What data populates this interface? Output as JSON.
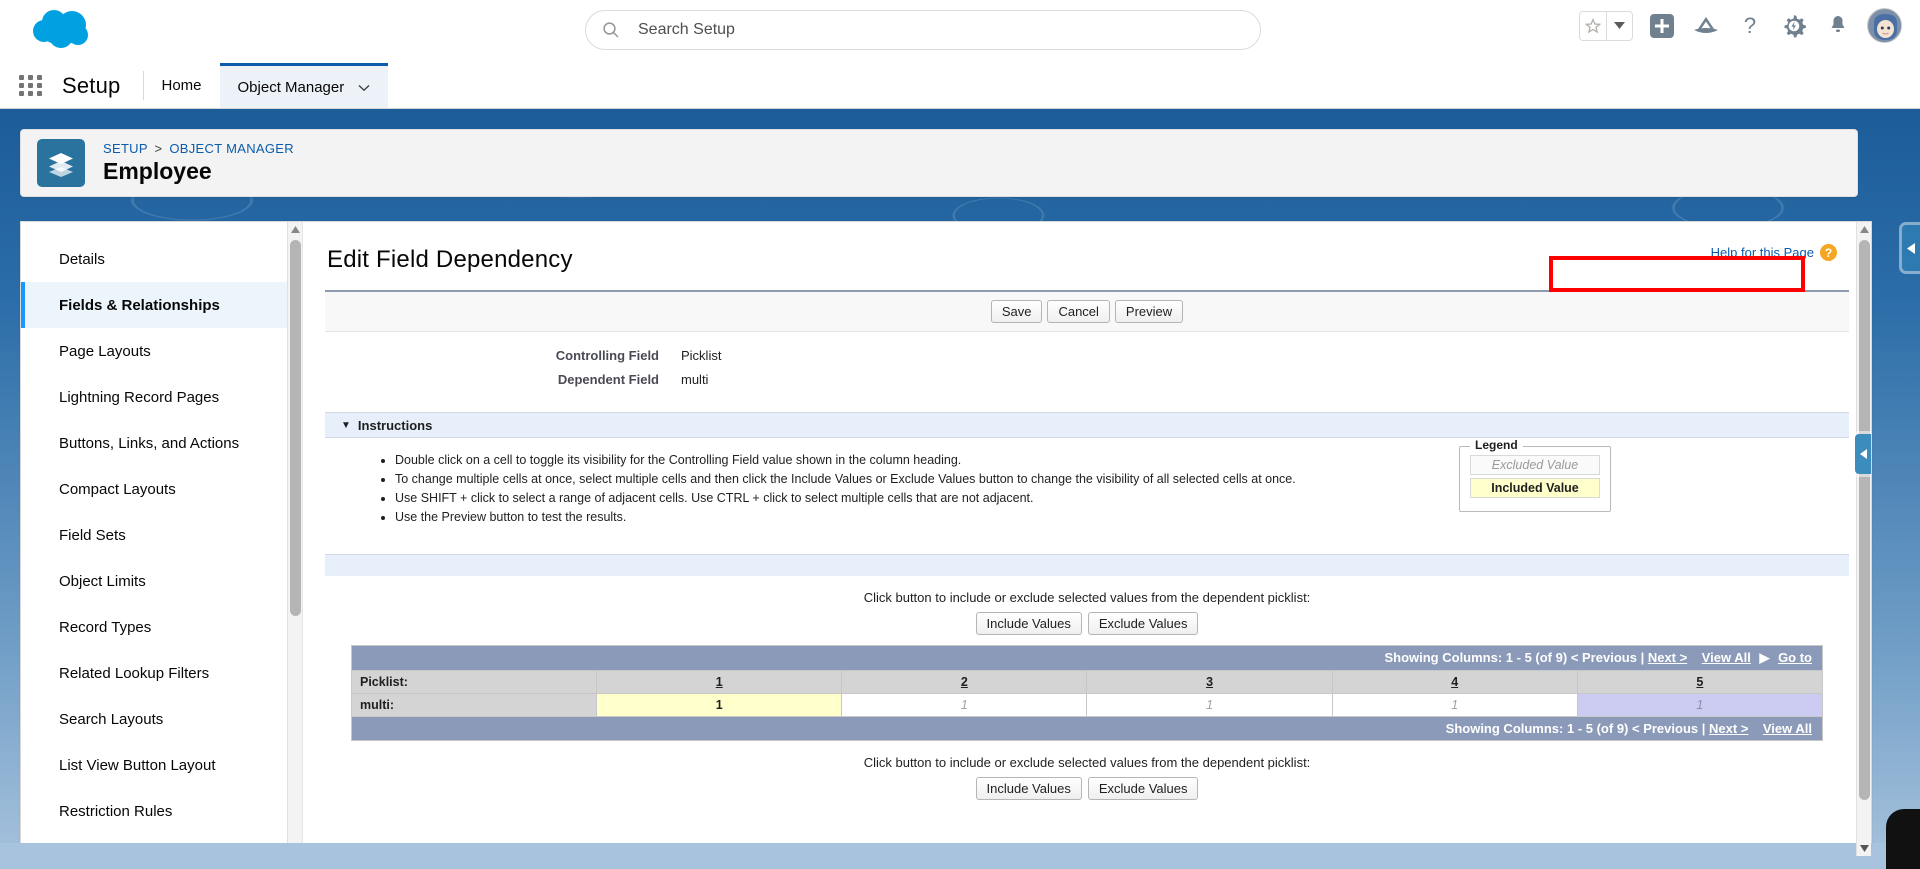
{
  "header": {
    "logo_name": "salesforce-cloud-logo",
    "search": {
      "placeholder": "Search Setup",
      "value": "",
      "icon": "search-icon"
    },
    "icons": [
      {
        "name": "favorites-star-icon",
        "glyph": "★"
      },
      {
        "name": "favorites-dropdown-icon",
        "glyph": "▾"
      },
      {
        "name": "global-actions-plus-icon",
        "glyph": "+"
      },
      {
        "name": "trailhead-icon",
        "glyph": "▲"
      },
      {
        "name": "help-question-icon",
        "glyph": "?"
      },
      {
        "name": "setup-gear-icon",
        "glyph": "⚙"
      },
      {
        "name": "notifications-bell-icon",
        "glyph": "🔔"
      },
      {
        "name": "user-avatar",
        "glyph": ""
      }
    ]
  },
  "setup_nav": {
    "app_launcher_label": "app-launcher",
    "title": "Setup",
    "tabs": [
      {
        "label": "Home",
        "active": false,
        "has_caret": false
      },
      {
        "label": "Object Manager",
        "active": true,
        "has_caret": true
      }
    ]
  },
  "record_header": {
    "icon_name": "object-stack-icon",
    "breadcrumb": {
      "root": "SETUP",
      "separator": ">",
      "current": "OBJECT MANAGER"
    },
    "object_name": "Employee"
  },
  "sidebar": {
    "items": [
      {
        "label": "Details",
        "active": false
      },
      {
        "label": "Fields & Relationships",
        "active": true
      },
      {
        "label": "Page Layouts",
        "active": false
      },
      {
        "label": "Lightning Record Pages",
        "active": false
      },
      {
        "label": "Buttons, Links, and Actions",
        "active": false
      },
      {
        "label": "Compact Layouts",
        "active": false
      },
      {
        "label": "Field Sets",
        "active": false
      },
      {
        "label": "Object Limits",
        "active": false
      },
      {
        "label": "Record Types",
        "active": false
      },
      {
        "label": "Related Lookup Filters",
        "active": false
      },
      {
        "label": "Search Layouts",
        "active": false
      },
      {
        "label": "List View Button Layout",
        "active": false
      },
      {
        "label": "Restriction Rules",
        "active": false
      }
    ]
  },
  "main": {
    "page_title": "Edit Field Dependency",
    "help_link": "Help for this Page",
    "toolbar": {
      "save_label": "Save",
      "cancel_label": "Cancel",
      "preview_label": "Preview"
    },
    "fields": [
      {
        "label": "Controlling Field",
        "value": "Picklist"
      },
      {
        "label": "Dependent Field",
        "value": "multi"
      }
    ],
    "instructions": {
      "section_title": "Instructions",
      "collapse_glyph": "▼",
      "bullets": [
        "Double click on a cell to toggle its visibility for the Controlling Field value shown in the column heading.",
        "To change multiple cells at once, select multiple cells and then click the Include Values or Exclude Values button to change the visibility of all selected cells at once.",
        "Use SHIFT + click to select a range of adjacent cells. Use CTRL + click to select multiple cells that are not adjacent.",
        "Use the Preview button to test the results."
      ]
    },
    "legend": {
      "title": "Legend",
      "excluded_label": "Excluded Value",
      "included_label": "Included Value",
      "excluded_color": "#fafafa",
      "included_color": "#ffffcc"
    },
    "picklist_actions": {
      "hint": "Click button to include or exclude selected values from the dependent picklist:",
      "include_label": "Include Values",
      "exclude_label": "Exclude Values"
    },
    "pager": {
      "showing_text": "Showing Columns: 1 - 5 (of 9)",
      "previous_label": "< Previous",
      "pipe": "|",
      "next_label": "Next >",
      "view_all_label": "View All",
      "arrow_glyph": "▶",
      "go_to_label": "Go to"
    },
    "matrix": {
      "controlling_row_label": "Picklist:",
      "dependent_row_label": "multi:",
      "columns": [
        "1",
        "2",
        "3",
        "4",
        "5"
      ],
      "cells": [
        {
          "value": "1",
          "state": "included"
        },
        {
          "value": "1",
          "state": "excluded"
        },
        {
          "value": "1",
          "state": "excluded"
        },
        {
          "value": "1",
          "state": "excluded"
        },
        {
          "value": "1",
          "state": "selected"
        }
      ]
    },
    "annotation": {
      "name": "red-highlight-box",
      "color": "#ff0000"
    }
  },
  "chrome": {
    "scroll_up_glyph": "▲",
    "scroll_down_glyph": "▼",
    "collapse_glyph": "◀"
  }
}
